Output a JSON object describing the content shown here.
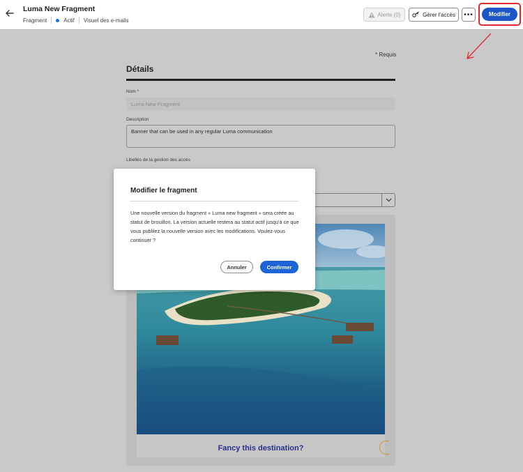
{
  "header": {
    "title": "Luma New Fragment",
    "breadcrumb": "Fragment",
    "status": "Actif",
    "type": "Visuel des e-mails",
    "alert_label": "Alerte (0)",
    "access_label": "Gérer l'accès",
    "more_label": "•••",
    "edit_label": "Modifier",
    "status_color": "#1473e6",
    "edit_color": "#1d56c7"
  },
  "form": {
    "required_note": "* Requis",
    "section_title": "Détails",
    "name_label": "Nom",
    "name_required_mark": "*",
    "name_placeholder": "Luma New Fragment",
    "description_label": "Description",
    "description_value": "Banner that can be used in any regular Luma communication",
    "access_labels_label": "Libellés de la gestion des accès"
  },
  "preview": {
    "caption": "Fancy this destination?"
  },
  "modal": {
    "title": "Modifier le fragment",
    "body": "Une nouvelle version du fragment « Luma new fragment » sera créée au statut de brouillon. La version actuelle restera au statut actif jusqu'à ce que vous publiiez la nouvelle version avec les modifications. Voulez-vous continuer ?",
    "cancel_label": "Annuler",
    "confirm_label": "Confirmer"
  }
}
